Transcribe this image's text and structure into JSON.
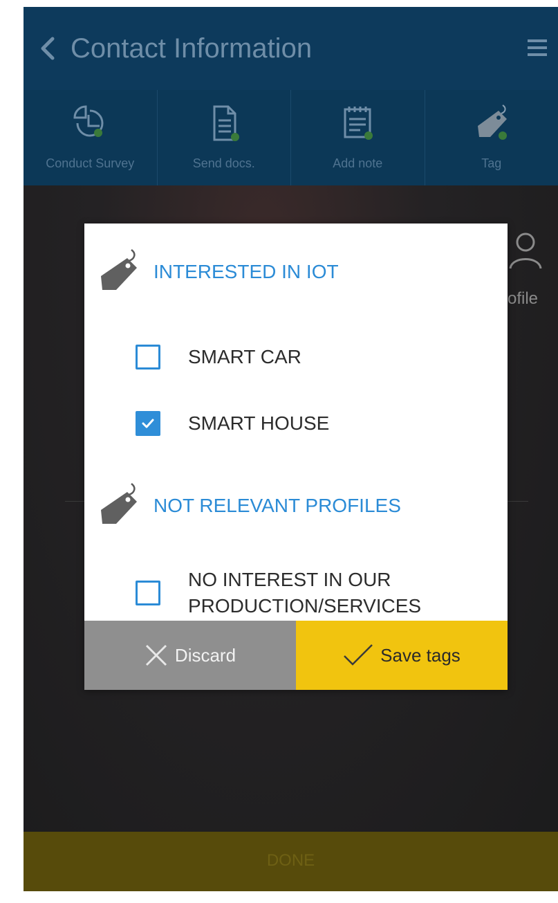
{
  "header": {
    "title": "Contact Information",
    "back_icon": "chevron-left-icon",
    "menu_icon": "hamburger-menu-icon"
  },
  "actions": [
    {
      "label": "Conduct Survey",
      "icon": "survey-chart-icon"
    },
    {
      "label": "Send docs.",
      "icon": "document-icon"
    },
    {
      "label": "Add note",
      "icon": "note-icon"
    },
    {
      "label": "Tag",
      "icon": "tag-icon"
    }
  ],
  "background": {
    "profile_label": "ofile",
    "done_label": "DONE"
  },
  "dialog": {
    "groups": [
      {
        "title": "INTERESTED IN IOT",
        "options": [
          {
            "label": "SMART CAR",
            "checked": false
          },
          {
            "label": "SMART HOUSE",
            "checked": true
          }
        ]
      },
      {
        "title": "NOT RELEVANT PROFILES",
        "options": [
          {
            "label": "NO INTEREST IN OUR PRODUCTION/SERVICES",
            "checked": false
          }
        ]
      }
    ],
    "discard_label": "Discard",
    "save_label": "Save tags"
  },
  "colors": {
    "header_bg": "#0d3a5c",
    "accent_blue": "#2b8bd6",
    "save_yellow": "#f1c40f",
    "discard_gray": "#8f8f8f"
  }
}
